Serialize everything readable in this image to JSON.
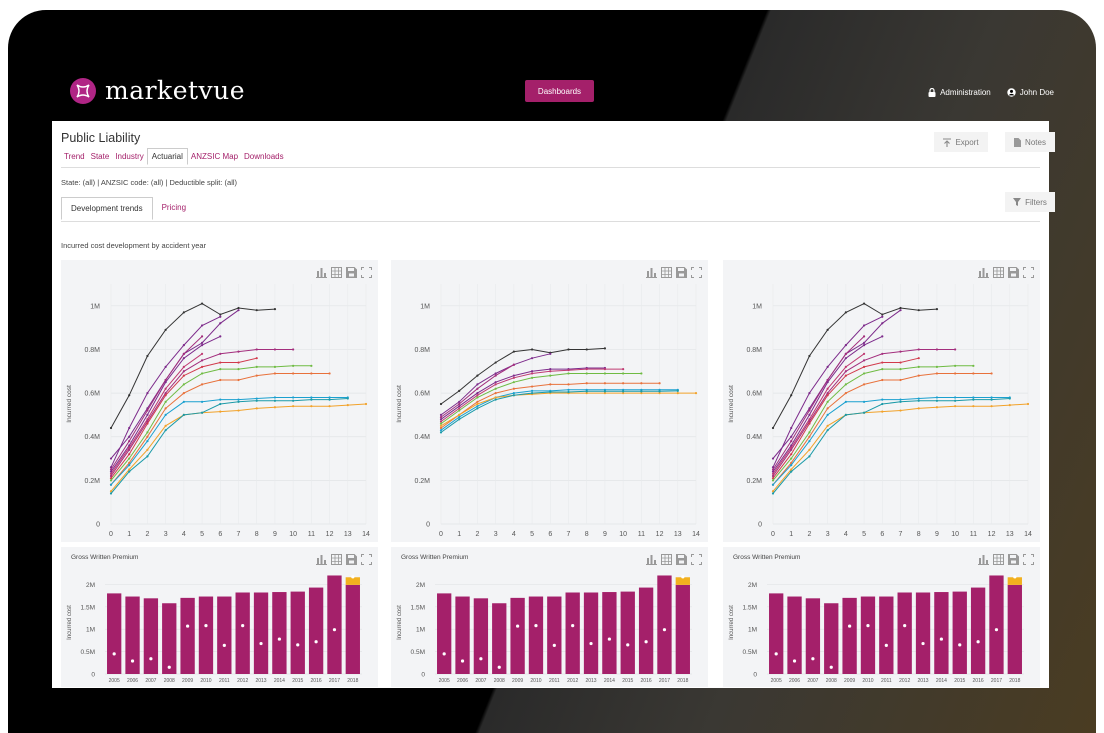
{
  "brand": {
    "name": "marketvue",
    "color": "#b02585"
  },
  "nav": {
    "dashboards_label": "Dashboards",
    "admin_label": "Administration",
    "user_label": "John Doe"
  },
  "page": {
    "title": "Public Liability"
  },
  "tabs": [
    {
      "label": "Trend",
      "active": false
    },
    {
      "label": "State",
      "active": false
    },
    {
      "label": "Industry",
      "active": false
    },
    {
      "label": "Actuarial",
      "active": true
    },
    {
      "label": "ANZSIC Map",
      "active": false
    },
    {
      "label": "Downloads",
      "active": false
    }
  ],
  "actions": {
    "export_label": "Export",
    "notes_label": "Notes",
    "filters_label": "Filters"
  },
  "filters_summary": "State: (all)  |  ANZSIC code: (all)  |  Deductible split: (all)",
  "subtabs": [
    {
      "label": "Development trends",
      "active": true
    },
    {
      "label": "Pricing",
      "active": false
    }
  ],
  "section_title": "Incurred cost development by accident year",
  "colors": {
    "accent": "#a4206a",
    "bar": "#a4206a",
    "bar_top": "#f2b01e",
    "card_bg": "#f3f4f6"
  },
  "icons": [
    "chart-icon",
    "table-icon",
    "save-icon",
    "fullscreen-icon",
    "lock-icon",
    "user-icon",
    "export-icon",
    "notes-icon",
    "filter-icon"
  ],
  "chart_data": [
    {
      "type": "line",
      "ylabel": "Incurred cost",
      "ylim": [
        0,
        1100000
      ],
      "yticks": [
        {
          "v": 0,
          "label": "0"
        },
        {
          "v": 200000,
          "label": "0.2M"
        },
        {
          "v": 400000,
          "label": "0.4M"
        },
        {
          "v": 600000,
          "label": "0.6M"
        },
        {
          "v": 800000,
          "label": "0.8M"
        },
        {
          "v": 1000000,
          "label": "1M"
        }
      ],
      "xticks": [
        "0",
        "1",
        "2",
        "3",
        "4",
        "5",
        "6",
        "7",
        "8",
        "9",
        "10",
        "11",
        "12",
        "13",
        "14"
      ],
      "series": [
        {
          "color": "#333333",
          "values": [
            440000,
            590000,
            770000,
            890000,
            970000,
            1010000,
            960000,
            990000,
            980000,
            985000
          ]
        },
        {
          "color": "#7d2b8b",
          "values": [
            260000,
            440000,
            600000,
            720000,
            820000,
            910000,
            950000
          ]
        },
        {
          "color": "#7d2b8b",
          "values": [
            300000,
            400000,
            530000,
            660000,
            780000,
            830000,
            920000,
            980000
          ]
        },
        {
          "color": "#a32e7d",
          "values": [
            250000,
            380000,
            520000,
            660000,
            780000,
            860000
          ]
        },
        {
          "color": "#7d2b8b",
          "values": [
            240000,
            360000,
            500000,
            650000,
            760000,
            820000,
            860000
          ]
        },
        {
          "color": "#c03a72",
          "values": [
            230000,
            350000,
            480000,
            620000,
            720000,
            780000
          ]
        },
        {
          "color": "#a32e7d",
          "values": [
            220000,
            340000,
            470000,
            600000,
            700000,
            750000,
            780000,
            790000,
            800000,
            800000,
            800000
          ]
        },
        {
          "color": "#d13a4c",
          "values": [
            210000,
            320000,
            460000,
            590000,
            680000,
            720000,
            740000,
            740000,
            760000
          ]
        },
        {
          "color": "#6fbb43",
          "values": [
            200000,
            300000,
            420000,
            560000,
            640000,
            690000,
            710000,
            710000,
            720000,
            720000,
            725000,
            725000
          ]
        },
        {
          "color": "#e8713b",
          "values": [
            180000,
            280000,
            400000,
            530000,
            600000,
            640000,
            660000,
            660000,
            680000,
            690000,
            690000,
            690000,
            690000
          ]
        },
        {
          "color": "#1aa0cf",
          "values": [
            180000,
            270000,
            380000,
            500000,
            560000,
            560000,
            570000,
            570000,
            575000,
            580000,
            580000,
            580000,
            580000,
            580000
          ]
        },
        {
          "color": "#f2a22a",
          "values": [
            150000,
            250000,
            340000,
            450000,
            500000,
            510000,
            515000,
            520000,
            530000,
            535000,
            540000,
            540000,
            540000,
            545000,
            550000
          ]
        },
        {
          "color": "#1b9aa8",
          "values": [
            140000,
            240000,
            310000,
            430000,
            500000,
            510000,
            550000,
            560000,
            565000,
            565000,
            565000,
            570000,
            570000,
            575000
          ]
        }
      ]
    },
    {
      "type": "line",
      "ylabel": "Incurred cost",
      "ylim": [
        0,
        1100000
      ],
      "yticks": [
        {
          "v": 0,
          "label": "0"
        },
        {
          "v": 200000,
          "label": "0.2M"
        },
        {
          "v": 400000,
          "label": "0.4M"
        },
        {
          "v": 600000,
          "label": "0.6M"
        },
        {
          "v": 800000,
          "label": "0.8M"
        },
        {
          "v": 1000000,
          "label": "1M"
        }
      ],
      "xticks": [
        "0",
        "1",
        "2",
        "3",
        "4",
        "5",
        "6",
        "7",
        "8",
        "9",
        "10",
        "11",
        "12",
        "13",
        "14"
      ],
      "series": [
        {
          "color": "#333333",
          "values": [
            550000,
            610000,
            680000,
            740000,
            790000,
            800000,
            785000,
            800000,
            800000,
            805000
          ]
        },
        {
          "color": "#7d2b8b",
          "values": [
            500000,
            560000,
            640000,
            690000,
            730000,
            760000,
            780000
          ]
        },
        {
          "color": "#a32e7d",
          "values": [
            490000,
            550000,
            620000,
            680000,
            730000
          ]
        },
        {
          "color": "#7d2b8b",
          "values": [
            480000,
            540000,
            600000,
            650000,
            680000,
            700000,
            710000,
            710000,
            715000,
            715000
          ]
        },
        {
          "color": "#c03a72",
          "values": [
            470000,
            530000,
            590000,
            640000,
            670000,
            690000,
            700000,
            705000,
            710000,
            710000,
            710000
          ]
        },
        {
          "color": "#6fbb43",
          "values": [
            460000,
            520000,
            580000,
            620000,
            650000,
            670000,
            680000,
            690000,
            690000,
            690000,
            690000,
            690000
          ]
        },
        {
          "color": "#e8713b",
          "values": [
            440000,
            500000,
            560000,
            600000,
            620000,
            630000,
            640000,
            640000,
            645000,
            645000,
            645000,
            645000,
            645000
          ]
        },
        {
          "color": "#1aa0cf",
          "values": [
            430000,
            490000,
            540000,
            580000,
            600000,
            610000,
            610000,
            615000,
            615000,
            615000,
            615000,
            615000,
            615000,
            615000
          ]
        },
        {
          "color": "#f2a22a",
          "values": [
            450000,
            500000,
            550000,
            580000,
            590000,
            595000,
            600000,
            600000,
            600000,
            600000,
            600000,
            600000,
            600000,
            600000,
            600000
          ]
        },
        {
          "color": "#1b9aa8",
          "values": [
            420000,
            480000,
            530000,
            570000,
            590000,
            600000,
            605000,
            605000,
            608000,
            608000,
            608000,
            608000,
            608000,
            610000
          ]
        }
      ]
    },
    {
      "type": "line",
      "ylabel": "Incurred cost",
      "ylim": [
        0,
        1100000
      ],
      "yticks": [
        {
          "v": 0,
          "label": "0"
        },
        {
          "v": 200000,
          "label": "0.2M"
        },
        {
          "v": 400000,
          "label": "0.4M"
        },
        {
          "v": 600000,
          "label": "0.6M"
        },
        {
          "v": 800000,
          "label": "0.8M"
        },
        {
          "v": 1000000,
          "label": "1M"
        }
      ],
      "xticks": [
        "0",
        "1",
        "2",
        "3",
        "4",
        "5",
        "6",
        "7",
        "8",
        "9",
        "10",
        "11",
        "12",
        "13",
        "14"
      ],
      "series": [
        {
          "color": "#333333",
          "values": [
            440000,
            590000,
            770000,
            890000,
            970000,
            1010000,
            960000,
            990000,
            980000,
            985000
          ]
        },
        {
          "color": "#7d2b8b",
          "values": [
            260000,
            440000,
            600000,
            720000,
            820000,
            910000,
            950000
          ]
        },
        {
          "color": "#7d2b8b",
          "values": [
            300000,
            400000,
            530000,
            660000,
            780000,
            830000,
            920000,
            980000
          ]
        },
        {
          "color": "#a32e7d",
          "values": [
            250000,
            380000,
            520000,
            660000,
            780000,
            860000
          ]
        },
        {
          "color": "#7d2b8b",
          "values": [
            240000,
            360000,
            500000,
            650000,
            760000,
            820000,
            860000
          ]
        },
        {
          "color": "#c03a72",
          "values": [
            230000,
            350000,
            480000,
            620000,
            720000,
            780000
          ]
        },
        {
          "color": "#a32e7d",
          "values": [
            220000,
            340000,
            470000,
            600000,
            700000,
            750000,
            780000,
            790000,
            800000,
            800000,
            800000
          ]
        },
        {
          "color": "#d13a4c",
          "values": [
            210000,
            320000,
            460000,
            590000,
            680000,
            720000,
            740000,
            740000,
            760000
          ]
        },
        {
          "color": "#6fbb43",
          "values": [
            200000,
            300000,
            420000,
            560000,
            640000,
            690000,
            710000,
            710000,
            720000,
            720000,
            725000,
            725000
          ]
        },
        {
          "color": "#e8713b",
          "values": [
            180000,
            280000,
            400000,
            530000,
            600000,
            640000,
            660000,
            660000,
            680000,
            690000,
            690000,
            690000,
            690000
          ]
        },
        {
          "color": "#1aa0cf",
          "values": [
            180000,
            270000,
            380000,
            500000,
            560000,
            560000,
            570000,
            570000,
            575000,
            580000,
            580000,
            580000,
            580000,
            580000
          ]
        },
        {
          "color": "#f2a22a",
          "values": [
            150000,
            250000,
            340000,
            450000,
            500000,
            510000,
            515000,
            520000,
            530000,
            535000,
            540000,
            540000,
            540000,
            545000,
            550000
          ]
        },
        {
          "color": "#1b9aa8",
          "values": [
            140000,
            240000,
            310000,
            430000,
            500000,
            510000,
            550000,
            560000,
            565000,
            565000,
            565000,
            570000,
            570000,
            575000
          ]
        }
      ]
    },
    {
      "type": "bar",
      "title": "Gross Written Premium",
      "ylabel": "Incurred cost",
      "ylim": [
        0,
        2300000
      ],
      "yticks": [
        {
          "v": 0,
          "label": "0"
        },
        {
          "v": 500000,
          "label": "0.5M"
        },
        {
          "v": 1000000,
          "label": "1M"
        },
        {
          "v": 1500000,
          "label": "1.5M"
        },
        {
          "v": 2000000,
          "label": "2M"
        }
      ],
      "categories": [
        "2005",
        "2006",
        "2007",
        "2008",
        "2009",
        "2010",
        "2011",
        "2012",
        "2013",
        "2014",
        "2015",
        "2016",
        "2017",
        "2018"
      ],
      "values": [
        1800000,
        1730000,
        1690000,
        1580000,
        1700000,
        1730000,
        1730000,
        1820000,
        1820000,
        1830000,
        1840000,
        1930000,
        2200000,
        1990000
      ],
      "stack_top": [
        0,
        0,
        0,
        0,
        0,
        0,
        0,
        0,
        0,
        0,
        0,
        0,
        0,
        170000
      ],
      "markers": [
        450000,
        290000,
        340000,
        150000,
        1070000,
        1080000,
        640000,
        1080000,
        680000,
        780000,
        650000,
        720000,
        990000,
        2170000
      ]
    },
    {
      "type": "bar",
      "title": "Gross Written Premium",
      "ylabel": "Incurred cost",
      "ylim": [
        0,
        2300000
      ],
      "yticks": [
        {
          "v": 0,
          "label": "0"
        },
        {
          "v": 500000,
          "label": "0.5M"
        },
        {
          "v": 1000000,
          "label": "1M"
        },
        {
          "v": 1500000,
          "label": "1.5M"
        },
        {
          "v": 2000000,
          "label": "2M"
        }
      ],
      "categories": [
        "2005",
        "2006",
        "2007",
        "2008",
        "2009",
        "2010",
        "2011",
        "2012",
        "2013",
        "2014",
        "2015",
        "2016",
        "2017",
        "2018"
      ],
      "values": [
        1800000,
        1730000,
        1690000,
        1580000,
        1700000,
        1730000,
        1730000,
        1820000,
        1820000,
        1830000,
        1840000,
        1930000,
        2200000,
        1990000
      ],
      "stack_top": [
        0,
        0,
        0,
        0,
        0,
        0,
        0,
        0,
        0,
        0,
        0,
        0,
        0,
        170000
      ],
      "markers": [
        450000,
        290000,
        340000,
        150000,
        1070000,
        1080000,
        640000,
        1080000,
        680000,
        780000,
        650000,
        720000,
        990000,
        2170000
      ]
    },
    {
      "type": "bar",
      "title": "Gross Written Premium",
      "ylabel": "Incurred cost",
      "ylim": [
        0,
        2300000
      ],
      "yticks": [
        {
          "v": 0,
          "label": "0"
        },
        {
          "v": 500000,
          "label": "0.5M"
        },
        {
          "v": 1000000,
          "label": "1M"
        },
        {
          "v": 1500000,
          "label": "1.5M"
        },
        {
          "v": 2000000,
          "label": "2M"
        }
      ],
      "categories": [
        "2005",
        "2006",
        "2007",
        "2008",
        "2009",
        "2010",
        "2011",
        "2012",
        "2013",
        "2014",
        "2015",
        "2016",
        "2017",
        "2018"
      ],
      "values": [
        1800000,
        1730000,
        1690000,
        1580000,
        1700000,
        1730000,
        1730000,
        1820000,
        1820000,
        1830000,
        1840000,
        1930000,
        2200000,
        1990000
      ],
      "stack_top": [
        0,
        0,
        0,
        0,
        0,
        0,
        0,
        0,
        0,
        0,
        0,
        0,
        0,
        170000
      ],
      "markers": [
        450000,
        290000,
        340000,
        150000,
        1070000,
        1080000,
        640000,
        1080000,
        680000,
        780000,
        650000,
        720000,
        990000,
        2170000
      ]
    }
  ]
}
